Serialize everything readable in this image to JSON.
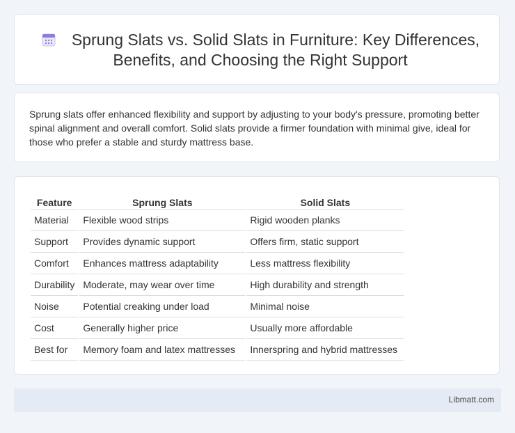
{
  "header": {
    "icon": "calendar-icon",
    "title": "Sprung Slats vs. Solid Slats in Furniture: Key Differences, Benefits, and Choosing the Right Support"
  },
  "intro": {
    "text": "Sprung slats offer enhanced flexibility and support by adjusting to your body's pressure, promoting better spinal alignment and overall comfort. Solid slats provide a firmer foundation with minimal give, ideal for those who prefer a stable and sturdy mattress base."
  },
  "table": {
    "headers": [
      "Feature",
      "Sprung Slats",
      "Solid Slats"
    ],
    "rows": [
      [
        "Material",
        "Flexible wood strips",
        "Rigid wooden planks"
      ],
      [
        "Support",
        "Provides dynamic support",
        "Offers firm, static support"
      ],
      [
        "Comfort",
        "Enhances mattress adaptability",
        "Less mattress flexibility"
      ],
      [
        "Durability",
        "Moderate, may wear over time",
        "High durability and strength"
      ],
      [
        "Noise",
        "Potential creaking under load",
        "Minimal noise"
      ],
      [
        "Cost",
        "Generally higher price",
        "Usually more affordable"
      ],
      [
        "Best for",
        "Memory foam and latex mattresses",
        "Innerspring and hybrid mattresses"
      ]
    ]
  },
  "footer": {
    "site": "Libmatt.com"
  },
  "colors": {
    "background": "#f1f4f9",
    "footer": "#e5ebf5",
    "icon_accent": "#8f7cd8"
  }
}
